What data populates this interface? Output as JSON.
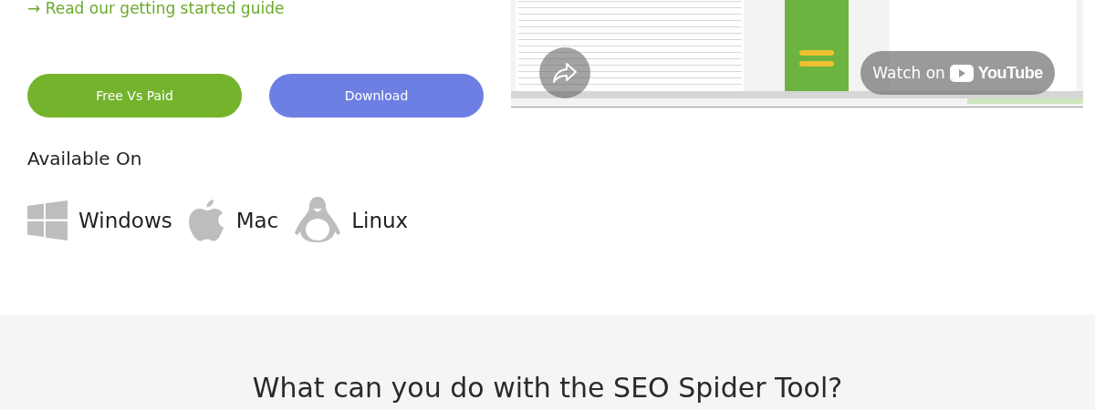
{
  "guide_link": {
    "arrow": "→",
    "label": "Read our getting started guide"
  },
  "buttons": [
    {
      "label": "Free Vs Paid",
      "kind": "green"
    },
    {
      "label": "Download",
      "kind": "blue"
    }
  ],
  "available_on": {
    "title": "Available On",
    "platforms": [
      {
        "kind": "windows",
        "label": "Windows"
      },
      {
        "kind": "apple",
        "label": "Mac"
      },
      {
        "kind": "linux",
        "label": "Linux"
      }
    ]
  },
  "video": {
    "kind": "picture",
    "watch_label": "Watch on",
    "brand": "YouTube"
  },
  "section": {
    "heading": "What can you do with the SEO Spider Tool?"
  }
}
